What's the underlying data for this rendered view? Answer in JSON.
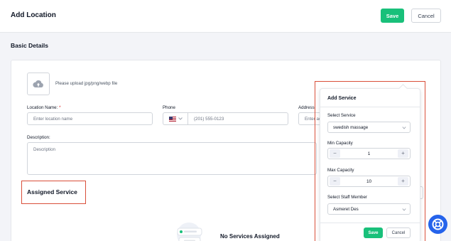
{
  "header": {
    "title": "Add Location",
    "save_label": "Save",
    "cancel_label": "Cancel"
  },
  "basic_details": {
    "heading": "Basic Details",
    "upload_hint": "Please upload jpg/png/webp file",
    "location_name_label": "Location Name:",
    "location_name_required": "*",
    "location_name_placeholder": "Enter location name",
    "phone_label": "Phone",
    "phone_country": "US",
    "phone_placeholder": "(201) 555-0123",
    "address_label": "Address:",
    "address_placeholder": "Enter address",
    "description_label": "Description:",
    "description_placeholder": "Description"
  },
  "assigned_service": {
    "heading": "Assigned Service",
    "empty_title": "No Services Assigned"
  },
  "add_service_popup": {
    "title": "Add Service",
    "select_service_label": "Select Service",
    "select_service_value": "swedish massage",
    "min_capacity_label": "Min Capacity",
    "min_capacity_value": "1",
    "max_capacity_label": "Max Capacity",
    "max_capacity_value": "10",
    "staff_label": "Select Staff Member",
    "staff_value": "Asmeret Des",
    "save_label": "Save",
    "cancel_label": "Cancel",
    "minus_symbol": "−",
    "plus_symbol": "+"
  },
  "colors": {
    "primary_green": "#19c07a",
    "highlight_red": "#d94f3a",
    "help_blue": "#2563eb"
  },
  "icons": [
    "cloud-upload-icon",
    "us-flag-icon",
    "chevron-down-icon",
    "help-lifebuoy-icon"
  ]
}
